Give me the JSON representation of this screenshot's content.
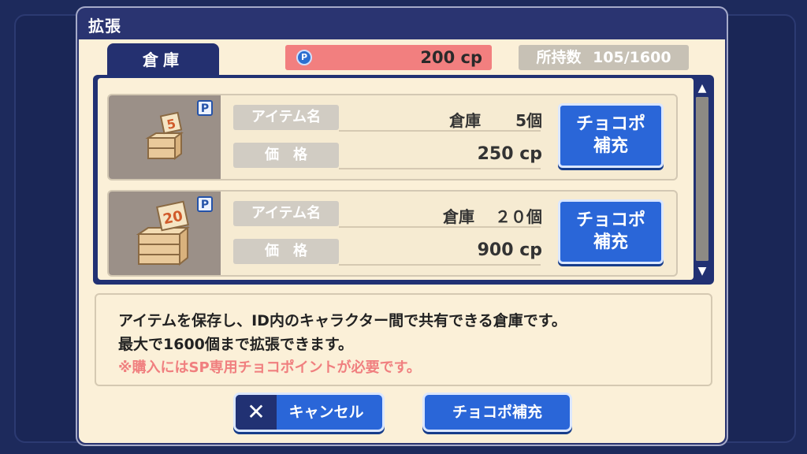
{
  "dialog": {
    "title": "拡張",
    "tab_label": "倉庫",
    "cp_icon": "coin-icon",
    "cp_value": "200 cp",
    "held_label": "所持数",
    "held_value": "105/1600"
  },
  "items": [
    {
      "badge": "P",
      "name_label": "アイテム名",
      "name": "倉庫",
      "qty": "5個",
      "price_label": "価　格",
      "price": "250 cp",
      "button": [
        "チョコポ",
        "補充"
      ],
      "crate_number": "5"
    },
    {
      "badge": "P",
      "name_label": "アイテム名",
      "name": "倉庫",
      "qty": "２０個",
      "price_label": "価　格",
      "price": "900 cp",
      "button": [
        "チョコポ",
        "補充"
      ],
      "crate_number": "20"
    }
  ],
  "description": {
    "line1": "アイテムを保存し、ID内のキャラクター間で共有できる倉庫です。",
    "line2": "最大で1600個まで拡張できます。",
    "warning": "※購入にはSP専用チョコポイントが必要です。"
  },
  "footer": {
    "cancel_label": "キャンセル",
    "supply_label": "チョコポ補充"
  },
  "colors": {
    "accent": "#2a66d8",
    "frame": "#213173",
    "warning_text": "#f07f7f",
    "cp_bar": "#f27f7f"
  }
}
